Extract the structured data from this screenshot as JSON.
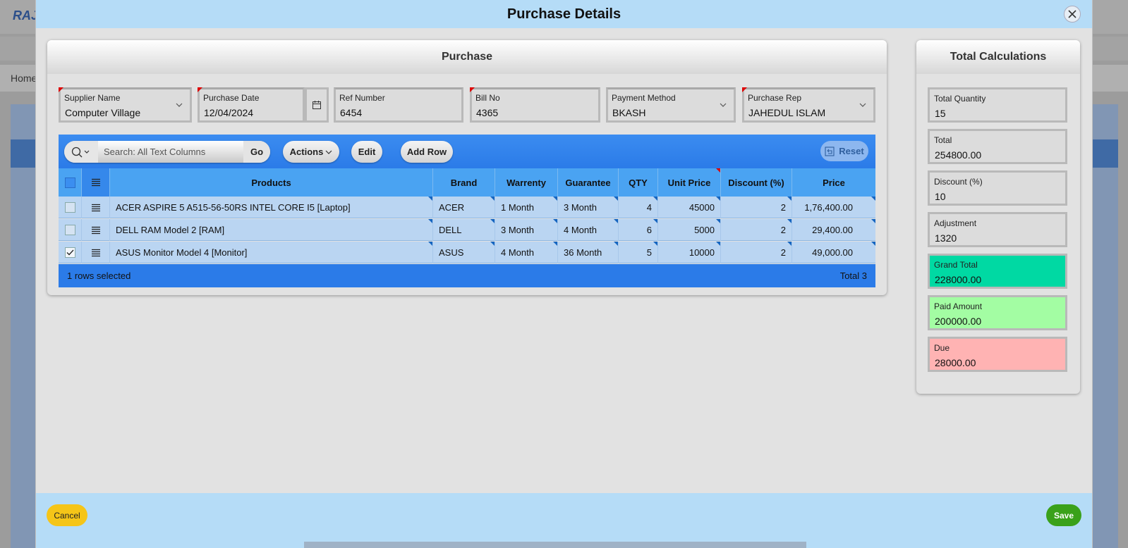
{
  "background": {
    "logo_text": "RAJ",
    "breadcrumb": "Home"
  },
  "modal": {
    "title": "Purchase Details"
  },
  "purchase": {
    "title": "Purchase",
    "fields": {
      "supplier": {
        "label": "Supplier Name",
        "value": "Computer Village"
      },
      "date": {
        "label": "Purchase Date",
        "value": "12/04/2024"
      },
      "ref": {
        "label": "Ref Number",
        "value": "6454"
      },
      "bill": {
        "label": "Bill No",
        "value": "4365"
      },
      "payment": {
        "label": "Payment Method",
        "value": "BKASH"
      },
      "rep": {
        "label": "Purchase Rep",
        "value": "JAHEDUL ISLAM"
      }
    }
  },
  "grid": {
    "search_placeholder": "Search: All Text Columns",
    "go_label": "Go",
    "actions_label": "Actions",
    "edit_label": "Edit",
    "add_row_label": "Add Row",
    "reset_label": "Reset",
    "columns": [
      "Products",
      "Brand",
      "Warrenty",
      "Guarantee",
      "QTY",
      "Unit Price",
      "Discount (%)",
      "Price"
    ],
    "rows": [
      {
        "product": "ACER ASPIRE 5 A515-56-50RS INTEL CORE I5 [Laptop]",
        "brand": "ACER",
        "warranty": "1 Month",
        "guarantee": "3 Month",
        "qty": "4",
        "unit_price": "45000",
        "discount": "2",
        "price": "1,76,400.00",
        "checked": false
      },
      {
        "product": "DELL RAM Model 2 [RAM]",
        "brand": "DELL",
        "warranty": "3 Month",
        "guarantee": "4 Month",
        "qty": "6",
        "unit_price": "5000",
        "discount": "2",
        "price": "29,400.00",
        "checked": false
      },
      {
        "product": "ASUS Monitor Model 4 [Monitor]",
        "brand": "ASUS",
        "warranty": "4 Month",
        "guarantee": "36 Month",
        "qty": "5",
        "unit_price": "10000",
        "discount": "2",
        "price": "49,000.00",
        "checked": true
      }
    ],
    "footer_selected": "1 rows selected",
    "footer_total": "Total 3"
  },
  "calculations": {
    "title": "Total Calculations",
    "total_quantity": {
      "label": "Total Quantity",
      "value": "15"
    },
    "total": {
      "label": "Total",
      "value": "254800.00"
    },
    "discount": {
      "label": "Discount (%)",
      "value": "10"
    },
    "adjustment": {
      "label": "Adjustment",
      "value": "1320"
    },
    "grand_total": {
      "label": "Grand Total",
      "value": "228000.00",
      "color": "#00d9a3"
    },
    "paid_amount": {
      "label": "Paid Amount",
      "value": "200000.00",
      "color": "#a3fda3"
    },
    "due": {
      "label": "Due",
      "value": "28000.00",
      "color": "#ffb3b3"
    }
  },
  "footer": {
    "cancel_label": "Cancel",
    "save_label": "Save",
    "cancel_color": "#f5c518",
    "save_color": "#3aa11a"
  }
}
